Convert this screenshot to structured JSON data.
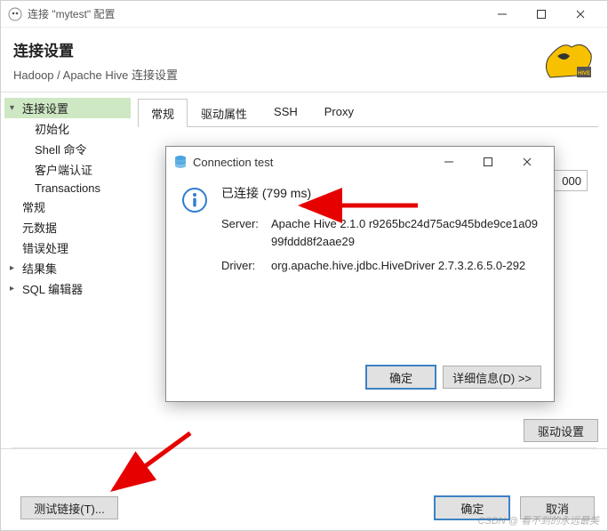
{
  "titlebar": {
    "title": "连接 \"mytest\" 配置"
  },
  "header": {
    "title": "连接设置",
    "subtitle": "Hadoop / Apache Hive 连接设置"
  },
  "tree": {
    "items": [
      {
        "label": "连接设置",
        "level": 0,
        "expandable": true,
        "selected": true
      },
      {
        "label": "初始化",
        "level": 1
      },
      {
        "label": "Shell 命令",
        "level": 1
      },
      {
        "label": "客户端认证",
        "level": 1
      },
      {
        "label": "Transactions",
        "level": 1
      },
      {
        "label": "常规",
        "level": 0
      },
      {
        "label": "元数据",
        "level": 0
      },
      {
        "label": "错误处理",
        "level": 0
      },
      {
        "label": "结果集",
        "level": 0,
        "expandable": true
      },
      {
        "label": "SQL 编辑器",
        "level": 0,
        "expandable": true
      }
    ]
  },
  "tabs": [
    "常规",
    "驱动属性",
    "SSH",
    "Proxy"
  ],
  "active_tab": 0,
  "form": {
    "port_value": "000"
  },
  "inner_footer": {
    "drv_button": "驱动设置"
  },
  "footer": {
    "test_button": "测试链接(T)...",
    "ok": "确定",
    "cancel": "取消"
  },
  "dialog": {
    "title": "Connection test",
    "message": "已连接 (799 ms)",
    "server_label": "Server:",
    "server_val": "Apache Hive 2.1.0 r9265bc24d75ac945bde9ce1a0999fddd8f2aae29",
    "driver_label": "Driver:",
    "driver_val": "org.apache.hive.jdbc.HiveDriver 2.7.3.2.6.5.0-292",
    "ok": "确定",
    "details": "详细信息(D) >>"
  },
  "watermark": "CSDN @ 看不到的永远最美"
}
